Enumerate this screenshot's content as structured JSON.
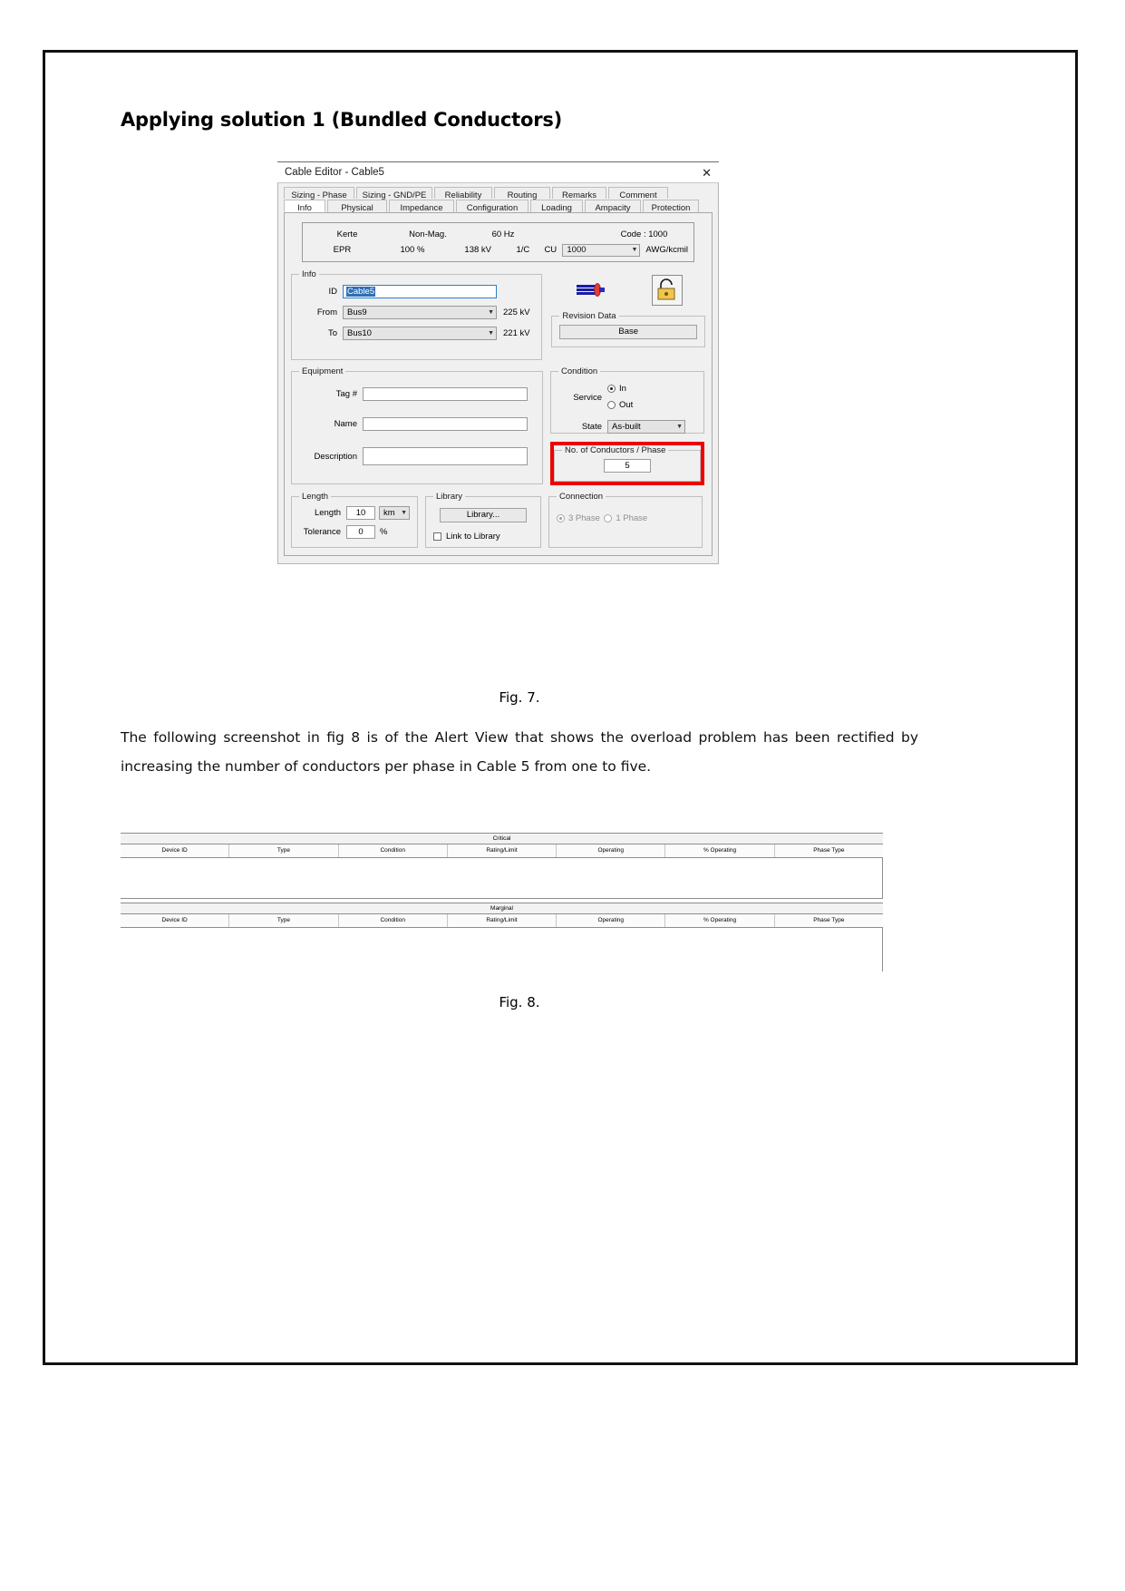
{
  "document": {
    "heading": "Applying solution 1 (Bundled Conductors)",
    "paragraph": "The following screenshot in fig 8 is of the Alert View that shows the overload problem has been rectified by increasing the number of conductors per phase in Cable 5 from one to five.",
    "fig7_caption": "Fig. 7.",
    "fig8_caption": "Fig. 8."
  },
  "dialog": {
    "title": "Cable Editor - Cable5",
    "close_label": "✕",
    "tabs_top": [
      "Sizing - Phase",
      "Sizing - GND/PE",
      "Reliability",
      "Routing",
      "Remarks",
      "Comment"
    ],
    "tabs_bottom": [
      "Info",
      "Physical",
      "Impedance",
      "Configuration",
      "Loading",
      "Ampacity",
      "Protection"
    ],
    "active_tab": "Info",
    "header": {
      "row1": {
        "name": "Kerte",
        "magnetic": "Non-Mag.",
        "frequency": "60 Hz",
        "code": "Code : 1000"
      },
      "row2": {
        "insulation": "EPR",
        "percent": "100 %",
        "voltage": "138 kV",
        "conductor_cfg": "1/C",
        "material": "CU",
        "size_value": "1000",
        "size_unit": "AWG/kcmil"
      }
    },
    "info": {
      "legend": "Info",
      "id_label": "ID",
      "id_value": "Cable5",
      "from_label": "From",
      "from_value": "Bus9",
      "from_kv": "225 kV",
      "to_label": "To",
      "to_value": "Bus10",
      "to_kv": "221 kV"
    },
    "revision": {
      "legend": "Revision Data",
      "button_label": "Base"
    },
    "equipment": {
      "legend": "Equipment",
      "tag_label": "Tag #",
      "tag_value": "",
      "name_label": "Name",
      "name_value": "",
      "description_label": "Description",
      "description_value": ""
    },
    "condition": {
      "legend": "Condition",
      "service_label": "Service",
      "service_in": "In",
      "service_out": "Out",
      "service_selected": "In",
      "state_label": "State",
      "state_value": "As-built"
    },
    "conductors": {
      "legend": "No. of Conductors / Phase",
      "value": "5",
      "highlight_color": "#ef0000"
    },
    "length": {
      "legend": "Length",
      "length_label": "Length",
      "length_value": "10",
      "length_unit": "km",
      "tolerance_label": "Tolerance",
      "tolerance_value": "0",
      "tolerance_unit": "%"
    },
    "library": {
      "legend": "Library",
      "button_label": "Library...",
      "link_label": "Link to Library",
      "link_checked": false
    },
    "connection": {
      "legend": "Connection",
      "three_phase": "3 Phase",
      "one_phase": "1 Phase",
      "selected": "3 Phase"
    },
    "icons": {
      "cable": "cable-icon",
      "lock": "lock-icon"
    }
  },
  "alert_view": {
    "sections": [
      {
        "title": "Critical",
        "columns": [
          "Device ID",
          "Type",
          "Condition",
          "Rating/Limit",
          "Operating",
          "% Operating",
          "Phase Type"
        ],
        "rows": []
      },
      {
        "title": "Marginal",
        "columns": [
          "Device ID",
          "Type",
          "Condition",
          "Rating/Limit",
          "Operating",
          "% Operating",
          "Phase Type"
        ],
        "rows": []
      }
    ]
  }
}
